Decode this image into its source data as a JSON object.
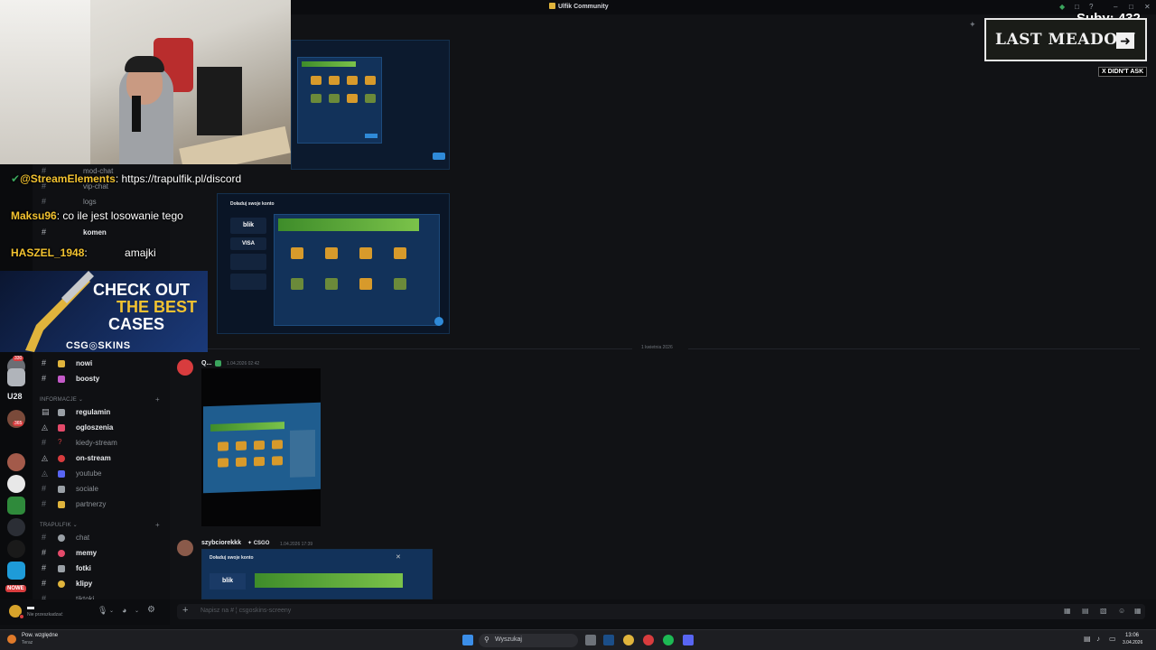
{
  "window": {
    "title": "Ulfik Community"
  },
  "overlay": {
    "subs": "Suby: 432",
    "sponsor_box_title": "LAST MEADOW",
    "didnt_ask": "X DIDN'T ASK",
    "chat": [
      {
        "user": "@StreamElements",
        "text": "https://trapulfik.pl/discord",
        "user_color": "#f2c230"
      },
      {
        "user": "Maksu96",
        "text": "co ile jest losowanie tego",
        "user_color": "#f2c230"
      },
      {
        "user": "HASZEL_1948",
        "text": "amajki",
        "user_color": "#f2c230"
      }
    ],
    "sponsor": {
      "line1": "CHECK OUT",
      "line2": "THE BEST",
      "line3": "CASES",
      "brand": "CSG◎SKINS"
    }
  },
  "rail": {
    "badges": [
      "330",
      "U28",
      "365",
      "NOWE"
    ]
  },
  "channels": {
    "top_items": [
      {
        "label": "mod-chat"
      },
      {
        "label": "vip-chat"
      },
      {
        "label": "logs"
      },
      {
        "label": "komen"
      }
    ],
    "items_group1": [
      {
        "label": "nowi",
        "bold": true,
        "color": "#e0b43c"
      },
      {
        "label": "boosty",
        "bold": true,
        "color": "#c45ac8"
      }
    ],
    "category_info": "INFORMACJE",
    "items_info": [
      {
        "label": "regulamin",
        "bold": true,
        "color": "#9aa0a6"
      },
      {
        "label": "ogloszenia",
        "bold": true,
        "color": "#e44a6a"
      },
      {
        "label": "kiedy-stream",
        "bold": false,
        "color": "#d83c3e"
      },
      {
        "label": "on-stream",
        "bold": true,
        "color": "#d83c3e"
      },
      {
        "label": "youtube",
        "bold": false,
        "color": "#5865f2"
      },
      {
        "label": "sociale",
        "bold": false,
        "color": "#9aa0a6"
      },
      {
        "label": "partnerzy",
        "bold": false,
        "color": "#e0b43c"
      }
    ],
    "on_stream_badge": "1",
    "category_trap": "TRAPULFIK",
    "items_trap": [
      {
        "label": "chat",
        "bold": false,
        "color": "#9aa0a6"
      },
      {
        "label": "memy",
        "bold": true,
        "color": "#e44a6a"
      },
      {
        "label": "fotki",
        "bold": true,
        "color": "#9aa0a6"
      },
      {
        "label": "klipy",
        "bold": true,
        "color": "#e0b43c"
      },
      {
        "label": "tiktoki",
        "bold": false,
        "color": "#9aa0a6"
      }
    ]
  },
  "user_panel": {
    "status": "Nie przeszkadzać"
  },
  "main": {
    "date_divider": "1 kwietnia 2026",
    "msg1": {
      "author": "Q...",
      "time": "1.04.2026 02:42"
    },
    "msg2": {
      "author": "szybciorekkk",
      "tag": "CSGO",
      "time": "1.04.2026 17:39"
    },
    "embed": {
      "title": "Doładuj swoje konto",
      "blik": "blik",
      "visa": "VISA"
    },
    "composer_placeholder": "Napisz na # ¦ csgoskins-screeny"
  },
  "taskbar": {
    "weather": "Pow. względne",
    "weather_sub": "Teraz",
    "search": "Wyszukaj",
    "time": "13:06",
    "date": "3.04.2026"
  }
}
